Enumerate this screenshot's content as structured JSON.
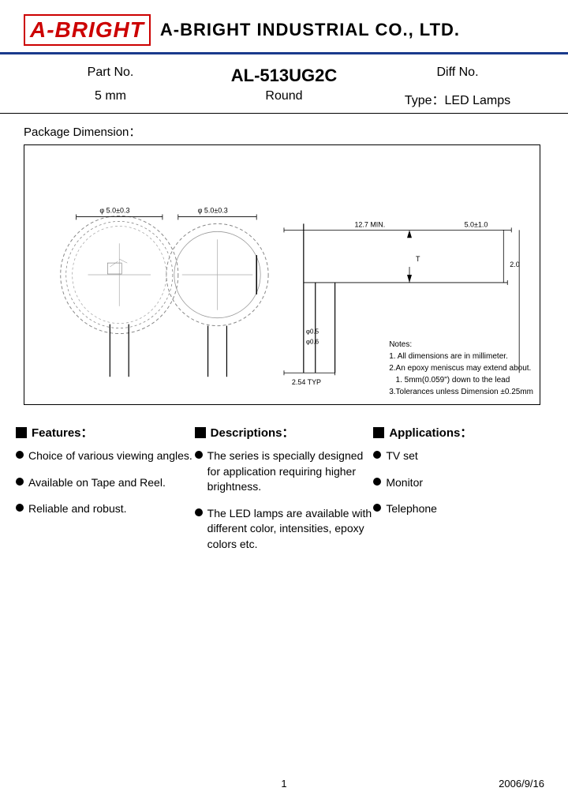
{
  "header": {
    "logo": "A-BRIGHT",
    "company": "A-BRIGHT INDUSTRIAL CO., LTD."
  },
  "part": {
    "part_no_label": "Part No.",
    "part_no_value": "AL-513UG2C",
    "diff_no_label": "Diff No.",
    "size_label": "5 mm",
    "shape_label": "Round",
    "type_label": "Type：LED Lamps"
  },
  "package": {
    "title": "Package Dimension：",
    "notes": [
      "Notes:",
      "1. All dimensions are in millimeter.",
      "2.An epoxy meniscus may extend about.",
      "   1. 5mm(0.059\") down to the lead",
      "3.Tolerances unless Dimension ±0.25mm"
    ]
  },
  "columns": {
    "features": {
      "header": "Features：",
      "items": [
        "Choice of various viewing angles.",
        "Available on Tape and Reel.",
        "Reliable and robust."
      ]
    },
    "descriptions": {
      "header": "Descriptions：",
      "items": [
        "The series is specially designed for application requiring higher brightness.",
        "The LED lamps are available with different color, intensities, epoxy colors etc."
      ]
    },
    "applications": {
      "header": "Applications：",
      "items": [
        "TV set",
        "Monitor",
        "Telephone"
      ]
    }
  },
  "footer": {
    "page": "1",
    "date": "2006/9/16"
  }
}
